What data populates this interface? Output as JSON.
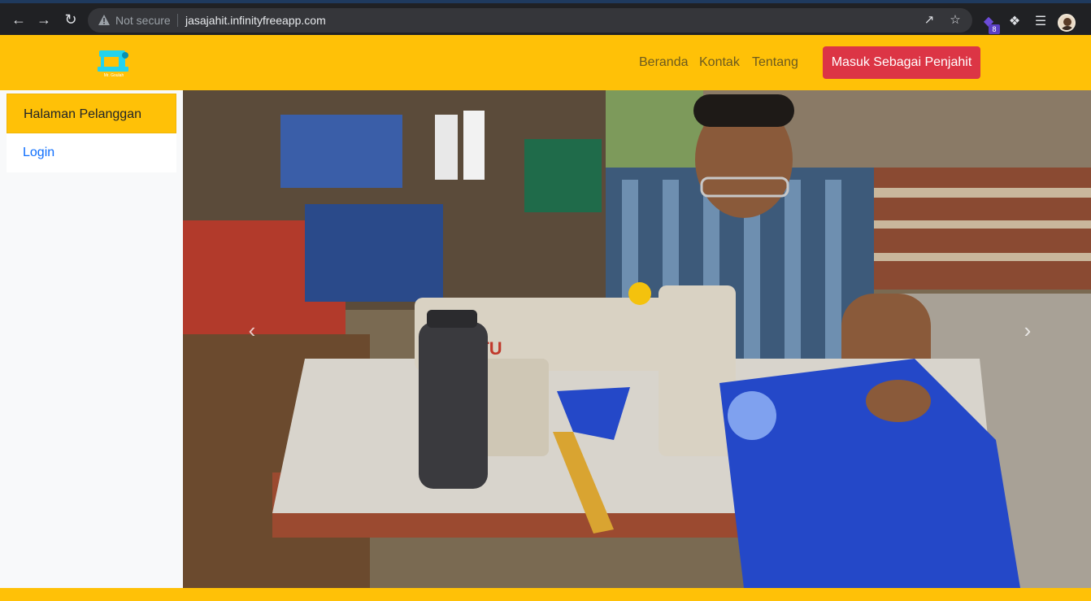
{
  "browser": {
    "security_label": "Not secure",
    "url": "jasajahit.infinityfreeapp.com",
    "extension_badge": "8"
  },
  "navbar": {
    "logo_text": "Mr. Goulah",
    "links": [
      "Beranda",
      "Kontak",
      "Tentang"
    ],
    "cta_label": "Masuk Sebagai Penjahit"
  },
  "sidebar": {
    "active_item": "Halaman Pelanggan",
    "items": [
      "Login"
    ]
  },
  "carousel": {
    "machine_brand_text": "JITU"
  },
  "colors": {
    "brand_yellow": "#ffc107",
    "cta_red": "#dc3545",
    "link_blue": "#0d6efd"
  }
}
